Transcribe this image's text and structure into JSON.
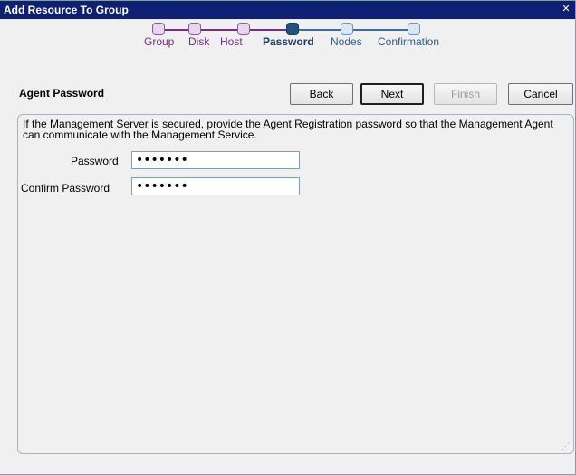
{
  "window": {
    "title": "Add Resource To Group",
    "close_glyph": "✕"
  },
  "wizard": {
    "steps": [
      {
        "label": "Group",
        "state": "done"
      },
      {
        "label": "Disk",
        "state": "done"
      },
      {
        "label": "Host",
        "state": "done"
      },
      {
        "label": "Password",
        "state": "current"
      },
      {
        "label": "Nodes",
        "state": "pending"
      },
      {
        "label": "Confirmation",
        "state": "pending"
      }
    ]
  },
  "header": {
    "section_title": "Agent Password"
  },
  "buttons": {
    "back": "Back",
    "next": "Next",
    "finish": "Finish",
    "cancel": "Cancel"
  },
  "content": {
    "description": "If the Management Server is secured, provide the Agent Registration password so that the Management Agent can communicate with the Management Service.",
    "password_label": "Password",
    "password_value": "•••••••",
    "confirm_label": "Confirm Password",
    "confirm_value": "•••••••"
  },
  "colors": {
    "titlebar": "#0f1f74",
    "done_step": "#7a2a8a",
    "current_step": "#1f4f7a",
    "pending_step": "#3a6ea5"
  }
}
